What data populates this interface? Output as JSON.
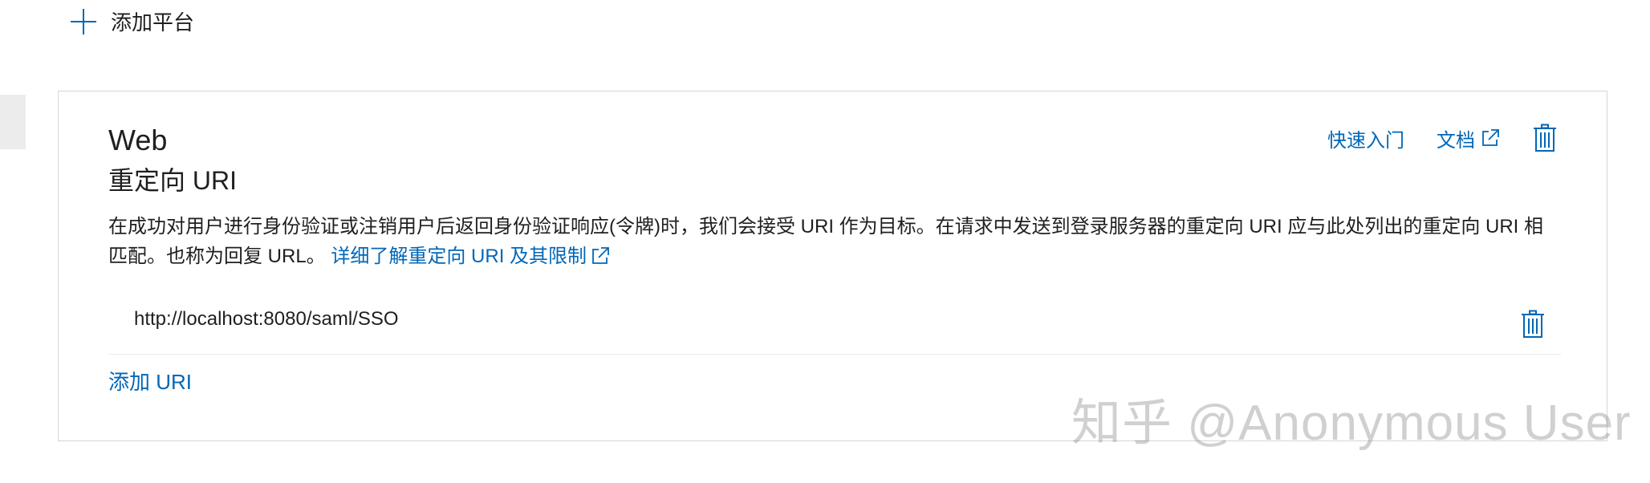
{
  "add_platform": {
    "label": "添加平台",
    "icon": "plus-icon"
  },
  "card": {
    "platform_title": "Web",
    "section_title": "重定向 URI",
    "actions": {
      "quickstart_label": "快速入门",
      "docs_label": "文档",
      "docs_icon": "external-link-icon",
      "delete_icon": "trash-icon"
    },
    "description": {
      "text": "在成功对用户进行身份验证或注销用户后返回身份验证响应(令牌)时，我们会接受 URI 作为目标。在请求中发送到登录服务器的重定向 URI 应与此处列出的重定向 URI 相匹配。也称为回复 URL。",
      "learn_more_label": "详细了解重定向 URI 及其限制",
      "learn_more_icon": "external-link-icon"
    },
    "uris": [
      {
        "value": "http://localhost:8080/saml/SSO",
        "delete_icon": "trash-icon"
      }
    ],
    "add_uri_label": "添加 URI"
  },
  "watermark": {
    "text": "知乎 @Anonymous User"
  },
  "colors": {
    "link": "#0067b8",
    "text": "#201f1e",
    "border": "#d6d6d6"
  }
}
